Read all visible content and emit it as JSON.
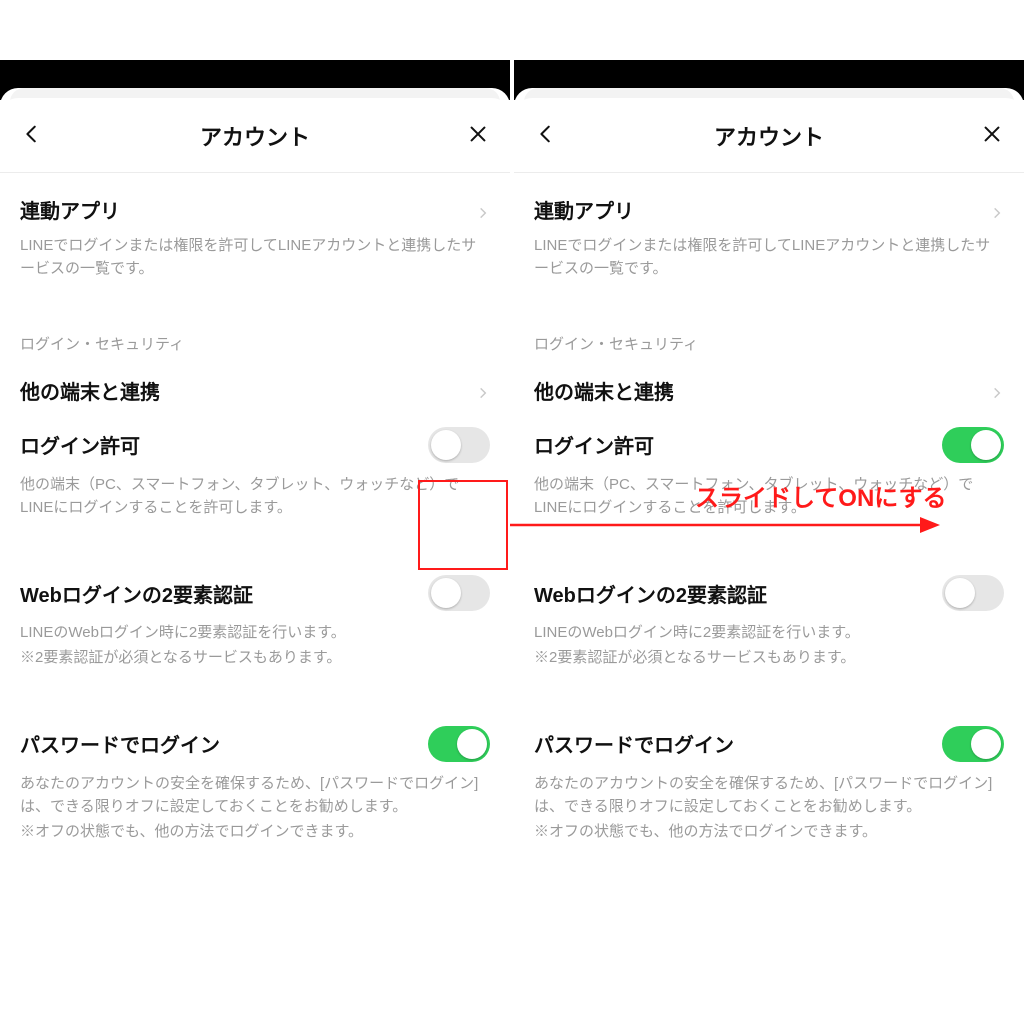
{
  "header": {
    "title": "アカウント"
  },
  "linked_apps": {
    "title": "連動アプリ",
    "desc": "LINEでログインまたは権限を許可してLINEアカウントと連携したサービスの一覧です。"
  },
  "security_group_label": "ログイン・セキュリティ",
  "link_devices": {
    "title": "他の端末と連携"
  },
  "login_allow": {
    "title": "ログイン許可",
    "desc": "他の端末（PC、スマートフォン、タブレット、ウォッチなど）でLINEにログインすることを許可します。"
  },
  "two_factor": {
    "title": "Webログインの2要素認証",
    "desc1": "LINEのWebログイン時に2要素認証を行います。",
    "desc2": "※2要素認証が必須となるサービスもあります。"
  },
  "password_login": {
    "title": "パスワードでログイン",
    "desc1": "あなたのアカウントの安全を確保するため、[パスワードでログイン]は、できる限りオフに設定しておくことをお勧めします。",
    "desc2": "※オフの状態でも、他の方法でログインできます。"
  },
  "toggles": {
    "left": {
      "login_allow": false,
      "two_factor": false,
      "password_login": true
    },
    "right": {
      "login_allow": true,
      "two_factor": false,
      "password_login": true
    }
  },
  "annotation": {
    "text": "スライドしてONにする"
  },
  "colors": {
    "toggle_on": "#2fce5a",
    "annotation": "#ff1a1a"
  }
}
